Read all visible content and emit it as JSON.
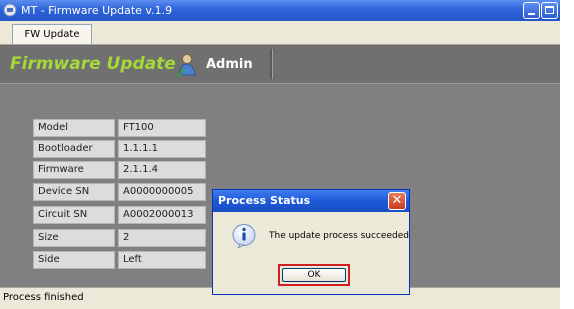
{
  "window": {
    "title": "MT - Firmware Update v.1.9"
  },
  "tabs": [
    {
      "label": "FW Update"
    }
  ],
  "banner": {
    "heading": "Firmware Update",
    "user_label": "Admin"
  },
  "device_info": [
    {
      "label": "Model",
      "value": "FT100"
    },
    {
      "label": "Bootloader",
      "value": "1.1.1.1"
    },
    {
      "label": "Firmware",
      "value": "2.1.1.4"
    },
    {
      "label": "Device SN",
      "value": "A0000000005"
    },
    {
      "label": "Circuit SN",
      "value": "A0002000013"
    },
    {
      "label": "Size",
      "value": "2"
    },
    {
      "label": "Side",
      "value": "Left"
    }
  ],
  "statusbar": {
    "text": "Process finished"
  },
  "dialog": {
    "title": "Process Status",
    "message": "The update process succeeded",
    "ok_label": "OK"
  },
  "colors": {
    "heading_green": "#a6d83a",
    "xp_blue": "#2356c8",
    "ok_highlight": "#d02020"
  },
  "icons": {
    "app": "app-icon",
    "user": "admin-user-icon",
    "dialog": "information-icon"
  }
}
